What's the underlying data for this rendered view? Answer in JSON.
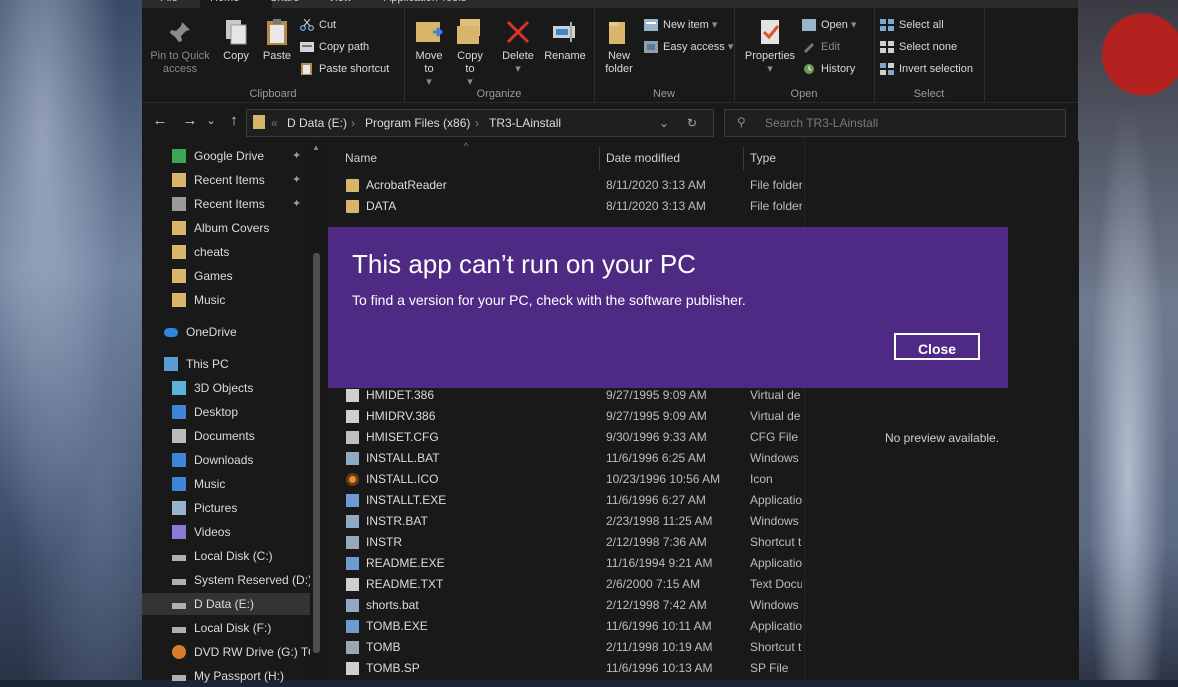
{
  "ribbon": {
    "tabs": [
      "File",
      "Home",
      "Share",
      "View",
      "Application Tools"
    ],
    "clipboard": {
      "pin_label": "Pin to Quick access",
      "copy_label": "Copy",
      "paste_label": "Paste",
      "cut_label": "Cut",
      "copy_path_label": "Copy path",
      "paste_shortcut_label": "Paste shortcut",
      "group_label": "Clipboard"
    },
    "organize": {
      "move_to_label": "Move to",
      "copy_to_label": "Copy to",
      "delete_label": "Delete",
      "rename_label": "Rename",
      "group_label": "Organize"
    },
    "new": {
      "new_folder_label": "New folder",
      "new_item_label": "New item",
      "easy_access_label": "Easy access",
      "group_label": "New"
    },
    "open": {
      "properties_label": "Properties",
      "open_label": "Open",
      "edit_label": "Edit",
      "history_label": "History",
      "group_label": "Open"
    },
    "select": {
      "select_all_label": "Select all",
      "select_none_label": "Select none",
      "invert_label": "Invert selection",
      "group_label": "Select"
    }
  },
  "address": {
    "breadcrumbs": [
      "D Data (E:)",
      "Program Files (x86)",
      "TR3-LAinstall"
    ],
    "search_placeholder": "Search TR3-LAinstall"
  },
  "navpane": {
    "items": [
      {
        "label": "Google Drive",
        "icon": "google-drive-icon",
        "pinned": true
      },
      {
        "label": "Recent Items",
        "icon": "folder-icon",
        "pinned": true
      },
      {
        "label": "Recent Items",
        "icon": "recent-icon",
        "pinned": true
      },
      {
        "label": "Album Covers",
        "icon": "folder-icon"
      },
      {
        "label": "cheats",
        "icon": "folder-icon"
      },
      {
        "label": "Games",
        "icon": "folder-icon"
      },
      {
        "label": "Music",
        "icon": "folder-icon"
      },
      {
        "label": "OneDrive",
        "icon": "onedrive-icon"
      },
      {
        "label": "This PC",
        "icon": "pc-icon"
      },
      {
        "label": "3D Objects",
        "icon": "3d-objects-icon"
      },
      {
        "label": "Desktop",
        "icon": "desktop-icon"
      },
      {
        "label": "Documents",
        "icon": "documents-icon"
      },
      {
        "label": "Downloads",
        "icon": "downloads-icon"
      },
      {
        "label": "Music",
        "icon": "music-icon"
      },
      {
        "label": "Pictures",
        "icon": "pictures-icon"
      },
      {
        "label": "Videos",
        "icon": "videos-icon"
      },
      {
        "label": "Local Disk (C:)",
        "icon": "drive-icon"
      },
      {
        "label": "System Reserved (D:)",
        "icon": "drive-icon"
      },
      {
        "label": "D Data (E:)",
        "icon": "drive-icon",
        "selected": true
      },
      {
        "label": "Local Disk (F:)",
        "icon": "drive-icon"
      },
      {
        "label": "DVD RW Drive (G:) TO",
        "icon": "dvd-drive-icon"
      },
      {
        "label": "My Passport (H:)",
        "icon": "drive-icon"
      }
    ]
  },
  "columns": {
    "name": "Name",
    "date": "Date modified",
    "type": "Type"
  },
  "files": [
    {
      "name": "AcrobatReader",
      "date": "8/11/2020 3:13 AM",
      "type": "File folder",
      "icon": "folder"
    },
    {
      "name": "DATA",
      "date": "8/11/2020 3:13 AM",
      "type": "File folder",
      "icon": "folder"
    },
    {
      "name": "HMIDET.386",
      "date": "9/27/1995 9:09 AM",
      "type": "Virtual de",
      "icon": "file"
    },
    {
      "name": "HMIDRV.386",
      "date": "9/27/1995 9:09 AM",
      "type": "Virtual de",
      "icon": "file"
    },
    {
      "name": "HMISET.CFG",
      "date": "9/30/1996 9:33 AM",
      "type": "CFG File",
      "icon": "cfg"
    },
    {
      "name": "INSTALL.BAT",
      "date": "11/6/1996 6:25 AM",
      "type": "Windows",
      "icon": "win"
    },
    {
      "name": "INSTALL.ICO",
      "date": "10/23/1996 10:56 AM",
      "type": "Icon",
      "icon": "ico"
    },
    {
      "name": "INSTALLT.EXE",
      "date": "11/6/1996 6:27 AM",
      "type": "Applicatio",
      "icon": "exe"
    },
    {
      "name": "INSTR.BAT",
      "date": "2/23/1998 11:25 AM",
      "type": "Windows",
      "icon": "win"
    },
    {
      "name": "INSTR",
      "date": "2/12/1998 7:36 AM",
      "type": "Shortcut t",
      "icon": "short"
    },
    {
      "name": "README.EXE",
      "date": "11/16/1994 9:21 AM",
      "type": "Applicatio",
      "icon": "exe"
    },
    {
      "name": "README.TXT",
      "date": "2/6/2000 7:15 AM",
      "type": "Text Docu",
      "icon": "file"
    },
    {
      "name": "shorts.bat",
      "date": "2/12/1998 7:42 AM",
      "type": "Windows",
      "icon": "win"
    },
    {
      "name": "TOMB.EXE",
      "date": "11/6/1996 10:11 AM",
      "type": "Applicatio",
      "icon": "exe"
    },
    {
      "name": "TOMB",
      "date": "2/11/1998 10:19 AM",
      "type": "Shortcut t",
      "icon": "short"
    },
    {
      "name": "TOMB.SP",
      "date": "11/6/1996 10:13 AM",
      "type": "SP File",
      "icon": "file"
    }
  ],
  "preview": {
    "text": "No preview available."
  },
  "dialog": {
    "title": "This app can’t run on your PC",
    "message": "To find a version for your PC, check with the software publisher.",
    "close_label": "Close"
  },
  "colors": {
    "dialog_bg": "#4e2a84",
    "explorer_bg": "#191919",
    "folder": "#d8b56a"
  }
}
